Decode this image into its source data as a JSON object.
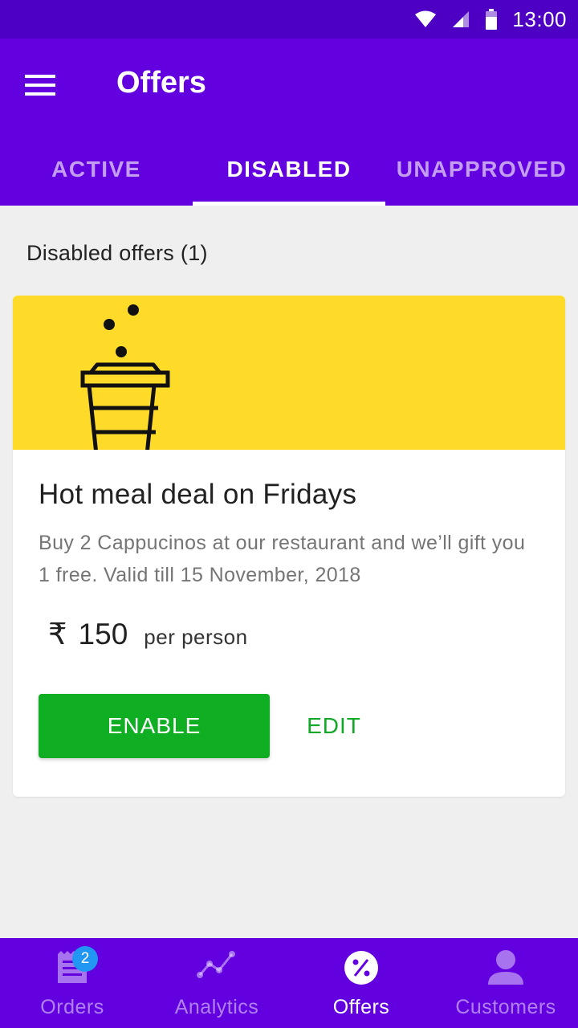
{
  "status_bar": {
    "time": "13:00"
  },
  "app_bar": {
    "title": "Offers"
  },
  "tabs": [
    {
      "label": "ACTIVE"
    },
    {
      "label": "DISABLED"
    },
    {
      "label": "UNAPPROVED"
    }
  ],
  "active_tab": "DISABLED",
  "section": {
    "title": "Disabled offers (1)"
  },
  "offer": {
    "title": "Hot meal deal on Fridays",
    "description": "Buy 2 Cappucinos at our restaurant and we’ll gift you 1 free. Valid till 15 November, 2018",
    "currency_symbol": "₹",
    "price": "150",
    "price_unit": "per person",
    "enable_label": "ENABLE",
    "edit_label": "EDIT",
    "banner_color": "#fedb29"
  },
  "bottom_nav": {
    "items": [
      {
        "label": "Orders",
        "icon": "receipt-icon",
        "badge": "2"
      },
      {
        "label": "Analytics",
        "icon": "analytics-icon"
      },
      {
        "label": "Offers",
        "icon": "offer-percent-icon"
      },
      {
        "label": "Customers",
        "icon": "person-icon"
      }
    ]
  },
  "colors": {
    "primary": "#6200e0",
    "status_bar": "#4d00c4",
    "accent_green": "#0fae23",
    "badge_blue": "#2196f3"
  }
}
